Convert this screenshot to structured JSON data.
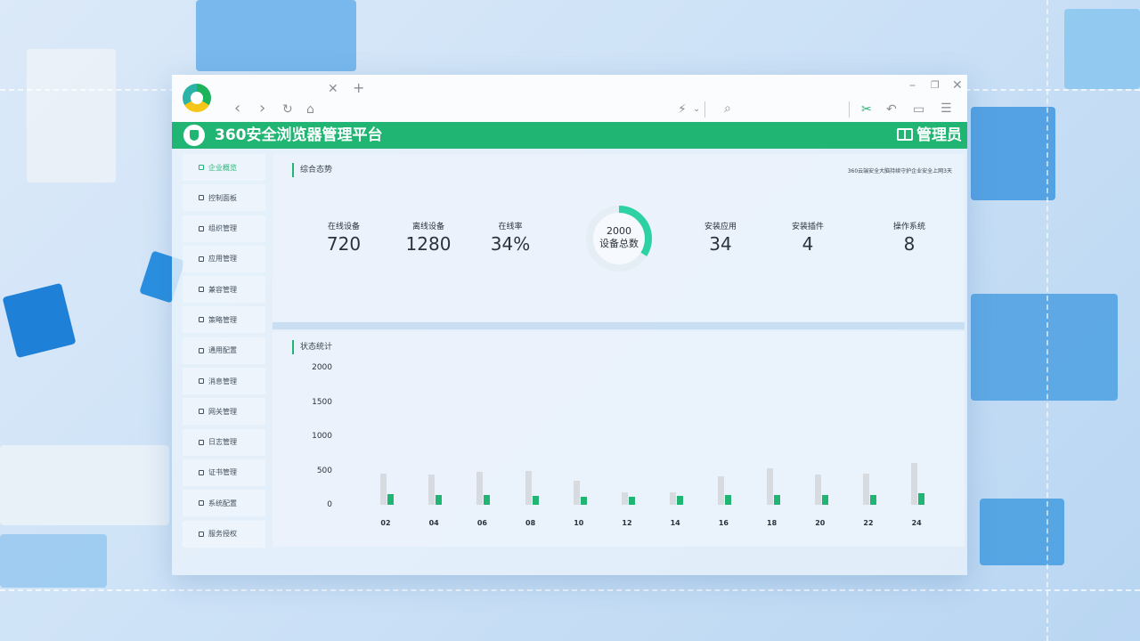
{
  "browser": {
    "address_placeholder": "",
    "search_placeholder": ""
  },
  "header": {
    "title": "360安全浏览器管理平台",
    "user": "管理员"
  },
  "sidebar": {
    "items": [
      {
        "label": "企业概览",
        "active": true
      },
      {
        "label": "控制面板"
      },
      {
        "label": "组织管理"
      },
      {
        "label": "应用管理"
      },
      {
        "label": "兼容管理"
      },
      {
        "label": "策略管理"
      },
      {
        "label": "通用配置"
      },
      {
        "label": "消息管理"
      },
      {
        "label": "网关管理"
      },
      {
        "label": "日志管理"
      },
      {
        "label": "证书管理"
      },
      {
        "label": "系统配置"
      },
      {
        "label": "服务授权"
      }
    ]
  },
  "overview": {
    "title": "综合态势",
    "marquee": "360云端安全大脑持续守护企业安全上网3天",
    "online": {
      "label": "在线设备",
      "value": "720"
    },
    "offline": {
      "label": "离线设备",
      "value": "1280"
    },
    "rate": {
      "label": "在线率",
      "value": "34%"
    },
    "total": {
      "value": "2000",
      "label": "设备总数",
      "online_fraction": 0.34
    },
    "apps": {
      "label": "安装应用",
      "value": "34"
    },
    "plugins": {
      "label": "安装插件",
      "value": "4"
    },
    "os": {
      "label": "操作系统",
      "value": "8"
    }
  },
  "status_chart": {
    "title": "状态统计"
  },
  "chart_data": {
    "type": "bar",
    "categories": [
      "02",
      "04",
      "06",
      "08",
      "10",
      "12",
      "14",
      "16",
      "18",
      "20",
      "22",
      "24"
    ],
    "series": [
      {
        "color": "#d7dade",
        "values": [
          460,
          440,
          480,
          500,
          350,
          180,
          180,
          420,
          540,
          440,
          460,
          610
        ]
      },
      {
        "color": "#21b573",
        "values": [
          160,
          150,
          150,
          130,
          120,
          120,
          130,
          140,
          140,
          140,
          150,
          170
        ]
      }
    ],
    "yticks": [
      "2000",
      "1500",
      "1000",
      "500",
      "0"
    ],
    "ylim": [
      0,
      2000
    ],
    "colors": {
      "accent": "#21b573",
      "gray": "#d7dade"
    }
  }
}
